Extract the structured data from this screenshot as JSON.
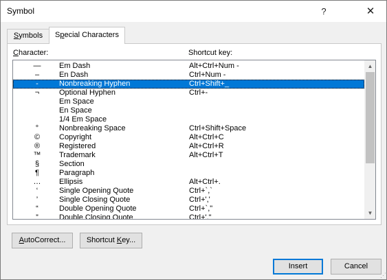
{
  "window": {
    "title": "Symbol",
    "help_glyph": "?",
    "close_glyph": "✕"
  },
  "tabs": [
    {
      "label_ul": "S",
      "label_rest": "ymbols",
      "active": false
    },
    {
      "label_pre": "S",
      "label_ul": "p",
      "label_rest": "ecial Characters",
      "active": true
    }
  ],
  "list": {
    "header_character_ul": "C",
    "header_character_rest": "haracter:",
    "header_shortcut": "Shortcut key:",
    "selected_index": 2,
    "rows": [
      {
        "symbol": "—",
        "name": "Em Dash",
        "shortcut": "Alt+Ctrl+Num -"
      },
      {
        "symbol": "–",
        "name": "En Dash",
        "shortcut": "Ctrl+Num -"
      },
      {
        "symbol": "-",
        "name": "Nonbreaking Hyphen",
        "shortcut": "Ctrl+Shift+_"
      },
      {
        "symbol": "¬",
        "name": "Optional Hyphen",
        "shortcut": "Ctrl+-"
      },
      {
        "symbol": "",
        "name": "Em Space",
        "shortcut": ""
      },
      {
        "symbol": "",
        "name": "En Space",
        "shortcut": ""
      },
      {
        "symbol": "",
        "name": "1/4 Em Space",
        "shortcut": ""
      },
      {
        "symbol": "°",
        "name": "Nonbreaking Space",
        "shortcut": "Ctrl+Shift+Space"
      },
      {
        "symbol": "©",
        "name": "Copyright",
        "shortcut": "Alt+Ctrl+C"
      },
      {
        "symbol": "®",
        "name": "Registered",
        "shortcut": "Alt+Ctrl+R"
      },
      {
        "symbol": "™",
        "name": "Trademark",
        "shortcut": "Alt+Ctrl+T"
      },
      {
        "symbol": "§",
        "name": "Section",
        "shortcut": ""
      },
      {
        "symbol": "¶",
        "name": "Paragraph",
        "shortcut": ""
      },
      {
        "symbol": "…",
        "name": "Ellipsis",
        "shortcut": "Alt+Ctrl+."
      },
      {
        "symbol": "‘",
        "name": "Single Opening Quote",
        "shortcut": "Ctrl+`,`"
      },
      {
        "symbol": "’",
        "name": "Single Closing Quote",
        "shortcut": "Ctrl+','"
      },
      {
        "symbol": "“",
        "name": "Double Opening Quote",
        "shortcut": "Ctrl+`,\""
      },
      {
        "symbol": "”",
        "name": "Double Closing Quote",
        "shortcut": "Ctrl+',\""
      }
    ]
  },
  "buttons": {
    "autocorrect_ul": "A",
    "autocorrect_rest": "utoCorrect...",
    "shortcut_pre": "Shortcut ",
    "shortcut_ul": "K",
    "shortcut_rest": "ey...",
    "insert": "Insert",
    "cancel": "Cancel"
  },
  "colors": {
    "selection": "#0078d7",
    "dialog_bg": "#f0f0f0",
    "default_button_border": "#0078d7"
  }
}
